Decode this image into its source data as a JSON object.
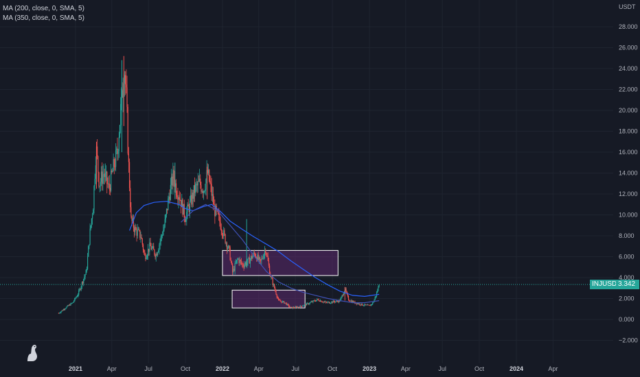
{
  "legend": {
    "ma1": "MA (200, close, 0, SMA, 5)",
    "ma2": "MA (350, close, 0, SMA, 5)"
  },
  "price_axis": {
    "unit": "USDT",
    "ticks": [
      "28.000",
      "26.000",
      "24.000",
      "22.000",
      "20.000",
      "18.000",
      "16.000",
      "14.000",
      "12.000",
      "10.000",
      "8.000",
      "6.000",
      "4.000",
      "2.000",
      "0.000",
      "−2.000"
    ]
  },
  "time_axis": {
    "ticks": [
      {
        "label": "2021",
        "bold": true
      },
      {
        "label": "Apr",
        "bold": false
      },
      {
        "label": "Jul",
        "bold": false
      },
      {
        "label": "Oct",
        "bold": false
      },
      {
        "label": "2022",
        "bold": true
      },
      {
        "label": "Apr",
        "bold": false
      },
      {
        "label": "Jul",
        "bold": false
      },
      {
        "label": "Oct",
        "bold": false
      },
      {
        "label": "2023",
        "bold": true
      },
      {
        "label": "Apr",
        "bold": false
      },
      {
        "label": "Jul",
        "bold": false
      },
      {
        "label": "Oct",
        "bold": false
      },
      {
        "label": "2024",
        "bold": true
      },
      {
        "label": "Apr",
        "bold": false
      }
    ]
  },
  "symbol_tag": {
    "symbol": "INJUSDT",
    "price": "3.342"
  },
  "colors": {
    "background": "#161a25",
    "up": "#26a69a",
    "down": "#ef5350",
    "ma200": "#2962ff",
    "ma350": "#3f51b5",
    "zone_fill": "#5d2a6e",
    "zone_stroke": "#ffffff",
    "price_line": "#26a69a",
    "grid": "#1f2430"
  },
  "chart_data": {
    "type": "candlestick",
    "symbol": "INJUSDT",
    "last_price": 3.342,
    "y_unit": "USDT",
    "ylim": [
      -2,
      28
    ],
    "xlim": [
      "2020-12-01",
      "2024-05-01"
    ],
    "price_path": [
      [
        "2020-11-20",
        0.6
      ],
      [
        "2020-12-10",
        1.2
      ],
      [
        "2020-12-25",
        1.6
      ],
      [
        "2021-01-08",
        2.5
      ],
      [
        "2021-01-20",
        3.8
      ],
      [
        "2021-01-28",
        4.6
      ],
      [
        "2021-02-05",
        8.0
      ],
      [
        "2021-02-14",
        11.0
      ],
      [
        "2021-02-21",
        16.5
      ],
      [
        "2021-03-01",
        13.0
      ],
      [
        "2021-03-12",
        14.0
      ],
      [
        "2021-03-25",
        12.5
      ],
      [
        "2021-04-05",
        14.5
      ],
      [
        "2021-04-15",
        16.0
      ],
      [
        "2021-04-25",
        21.0
      ],
      [
        "2021-05-02",
        24.5
      ],
      [
        "2021-05-08",
        20.5
      ],
      [
        "2021-05-12",
        15.5
      ],
      [
        "2021-05-19",
        9.5
      ],
      [
        "2021-05-30",
        8.5
      ],
      [
        "2021-06-12",
        8.0
      ],
      [
        "2021-06-22",
        6.0
      ],
      [
        "2021-07-05",
        7.0
      ],
      [
        "2021-07-20",
        6.2
      ],
      [
        "2021-07-30",
        7.5
      ],
      [
        "2021-08-10",
        9.0
      ],
      [
        "2021-08-22",
        12.0
      ],
      [
        "2021-09-01",
        13.8
      ],
      [
        "2021-09-08",
        12.5
      ],
      [
        "2021-09-15",
        12.0
      ],
      [
        "2021-09-30",
        9.8
      ],
      [
        "2021-10-12",
        11.0
      ],
      [
        "2021-10-25",
        12.5
      ],
      [
        "2021-11-05",
        13.0
      ],
      [
        "2021-11-15",
        12.5
      ],
      [
        "2021-11-25",
        14.0
      ],
      [
        "2021-12-03",
        12.5
      ],
      [
        "2021-12-12",
        10.5
      ],
      [
        "2021-12-24",
        9.5
      ],
      [
        "2022-01-05",
        8.0
      ],
      [
        "2022-01-18",
        6.5
      ],
      [
        "2022-01-26",
        4.5
      ],
      [
        "2022-02-08",
        5.8
      ],
      [
        "2022-02-20",
        5.2
      ],
      [
        "2022-03-05",
        5.5
      ],
      [
        "2022-03-22",
        6.3
      ],
      [
        "2022-04-05",
        5.4
      ],
      [
        "2022-04-18",
        6.8
      ],
      [
        "2022-04-30",
        4.2
      ],
      [
        "2022-05-10",
        3.0
      ],
      [
        "2022-05-20",
        1.8
      ],
      [
        "2022-06-05",
        1.6
      ],
      [
        "2022-06-20",
        1.1
      ],
      [
        "2022-07-10",
        1.2
      ],
      [
        "2022-08-01",
        1.5
      ],
      [
        "2022-08-25",
        1.9
      ],
      [
        "2022-09-15",
        1.6
      ],
      [
        "2022-10-05",
        1.7
      ],
      [
        "2022-10-20",
        1.8
      ],
      [
        "2022-11-01",
        2.9
      ],
      [
        "2022-11-10",
        1.9
      ],
      [
        "2022-11-25",
        1.6
      ],
      [
        "2022-12-15",
        1.4
      ],
      [
        "2023-01-01",
        1.3
      ],
      [
        "2023-01-10",
        1.6
      ],
      [
        "2023-01-18",
        2.4
      ],
      [
        "2023-01-25",
        3.342
      ]
    ],
    "spikes": [
      {
        "date": "2021-05-01",
        "high": 25.2,
        "low": 18.5
      },
      {
        "date": "2021-04-26",
        "high": 24.8,
        "low": 16.0
      },
      {
        "date": "2021-02-22",
        "high": 17.0,
        "low": 12.5
      },
      {
        "date": "2021-09-05",
        "high": 15.0,
        "low": 11.5
      },
      {
        "date": "2021-11-24",
        "high": 14.6,
        "low": 11.5
      },
      {
        "date": "2022-03-02",
        "high": 9.6,
        "low": 5.0
      },
      {
        "date": "2022-11-01",
        "high": 3.1,
        "low": 1.8
      }
    ],
    "series": [
      {
        "name": "MA (200, close, 0, SMA, 5)",
        "type": "line",
        "points": [
          [
            "2021-05-15",
            8.5
          ],
          [
            "2021-06-01",
            10.2
          ],
          [
            "2021-06-20",
            10.9
          ],
          [
            "2021-07-15",
            11.2
          ],
          [
            "2021-08-15",
            11.3
          ],
          [
            "2021-09-15",
            11.0
          ],
          [
            "2021-10-01",
            10.6
          ],
          [
            "2021-10-20",
            10.4
          ],
          [
            "2021-11-15",
            10.8
          ],
          [
            "2021-12-05",
            11.0
          ],
          [
            "2021-12-25",
            10.4
          ],
          [
            "2022-01-20",
            9.4
          ],
          [
            "2022-02-20",
            8.6
          ],
          [
            "2022-03-20",
            7.9
          ],
          [
            "2022-04-20",
            7.2
          ],
          [
            "2022-05-20",
            6.5
          ],
          [
            "2022-06-20",
            5.6
          ],
          [
            "2022-07-20",
            4.8
          ],
          [
            "2022-08-20",
            4.0
          ],
          [
            "2022-09-20",
            3.3
          ],
          [
            "2022-10-20",
            2.7
          ],
          [
            "2022-11-20",
            2.3
          ],
          [
            "2022-12-20",
            2.2
          ],
          [
            "2023-01-25",
            2.4
          ]
        ]
      },
      {
        "name": "MA (350, close, 0, SMA, 5)",
        "type": "line",
        "points": [
          [
            "2021-09-20",
            9.3
          ],
          [
            "2021-10-20",
            10.4
          ],
          [
            "2021-11-20",
            11.0
          ],
          [
            "2021-12-20",
            10.4
          ],
          [
            "2022-01-20",
            9.0
          ],
          [
            "2022-02-20",
            7.6
          ],
          [
            "2022-03-20",
            6.1
          ],
          [
            "2022-04-20",
            4.6
          ],
          [
            "2022-05-20",
            3.6
          ],
          [
            "2022-06-20",
            3.0
          ],
          [
            "2022-07-20",
            2.6
          ],
          [
            "2022-08-20",
            2.3
          ],
          [
            "2022-09-20",
            2.0
          ],
          [
            "2022-10-20",
            1.8
          ],
          [
            "2022-11-20",
            1.6
          ],
          [
            "2022-12-20",
            1.6
          ],
          [
            "2023-01-25",
            1.8
          ]
        ]
      }
    ],
    "zones": [
      {
        "from": "2022-01-01",
        "to": "2022-10-15",
        "top": 6.6,
        "bottom": 4.2
      },
      {
        "from": "2022-01-25",
        "to": "2022-07-25",
        "top": 2.8,
        "bottom": 1.1
      }
    ]
  }
}
